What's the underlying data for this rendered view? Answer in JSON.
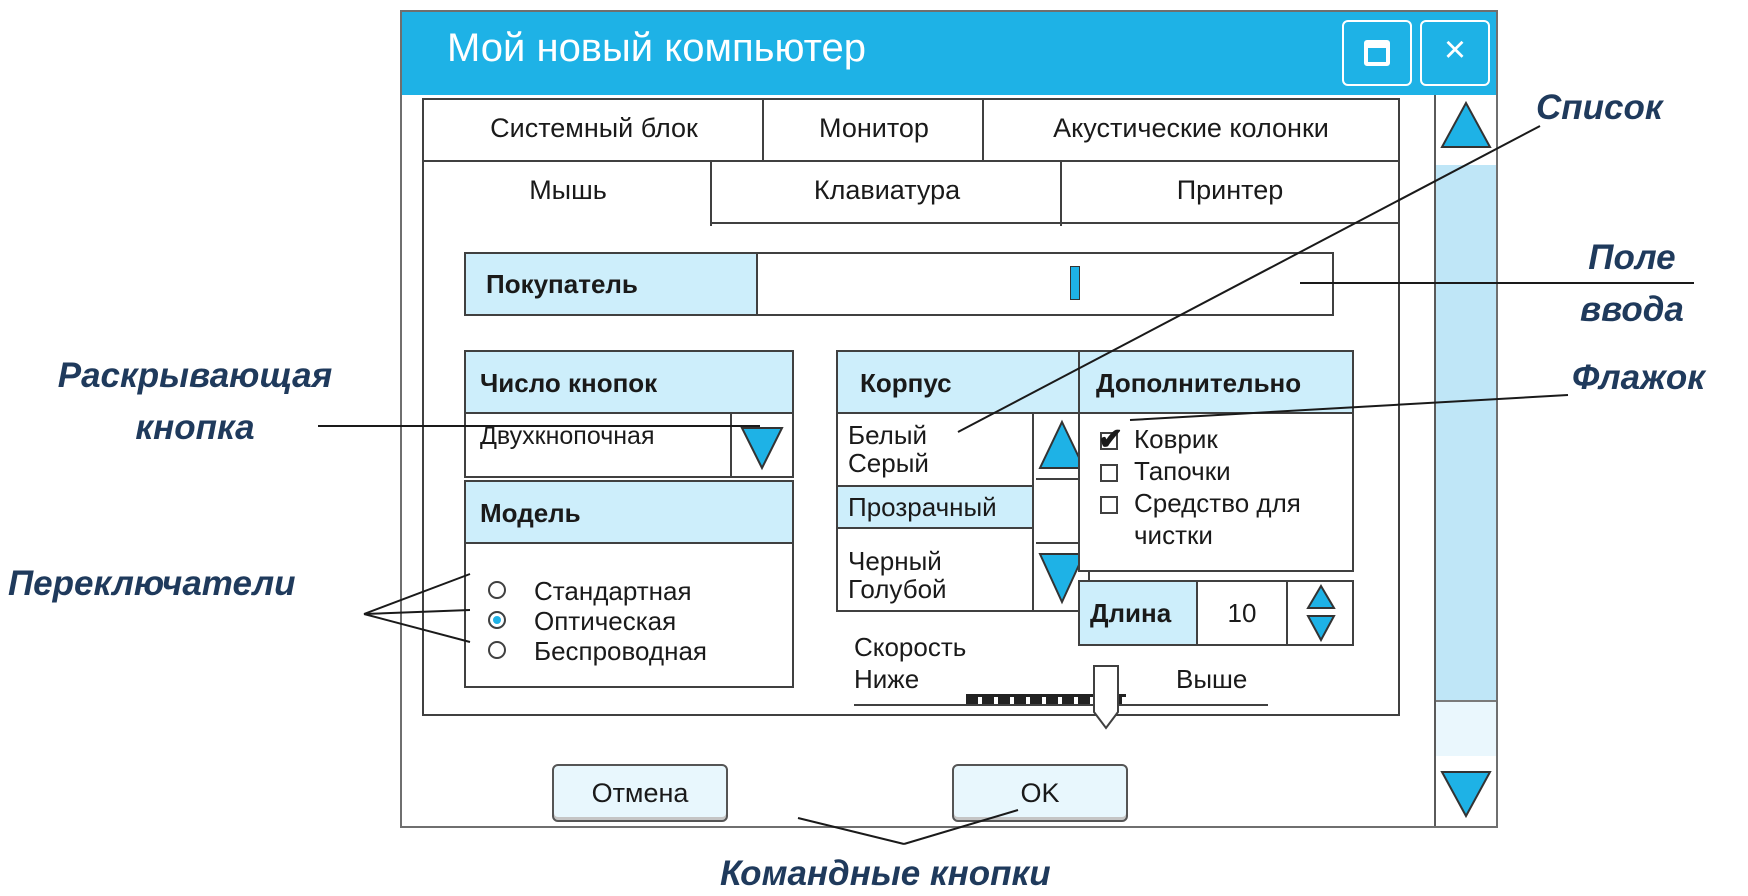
{
  "window": {
    "title": "Мой новый компьютер",
    "maximize_icon": "maximize-icon",
    "close_icon": "close-icon",
    "close_glyph": "×"
  },
  "tabs": {
    "row1": [
      "Системный блок",
      "Монитор",
      "Акустические колонки"
    ],
    "row2": [
      "Мышь",
      "Клавиатура",
      "Принтер"
    ],
    "active": "Мышь"
  },
  "buyer": {
    "label": "Покупатель",
    "value": ""
  },
  "buttons_group": {
    "label": "Число кнопок",
    "selected": "Двухкнопочная"
  },
  "model_group": {
    "label": "Модель",
    "options": [
      "Стандартная",
      "Оптическая",
      "Беспроводная"
    ],
    "selected": "Оптическая"
  },
  "body_group": {
    "label": "Корпус",
    "items": [
      "Белый",
      "Серый",
      "Прозрачный",
      "Черный",
      "Голубой"
    ],
    "selected": "Прозрачный"
  },
  "extra_group": {
    "label": "Дополнительно",
    "items": [
      {
        "label": "Коврик",
        "checked": true
      },
      {
        "label": "Тапочки",
        "checked": false
      },
      {
        "label": "Средство для",
        "label2": "чистки",
        "checked": false
      }
    ]
  },
  "length": {
    "label": "Длина",
    "value": "10"
  },
  "speed": {
    "label": "Скорость",
    "low": "Ниже",
    "high": "Выше",
    "level": 0.8
  },
  "commands": {
    "cancel": "Отмена",
    "ok": "OK"
  },
  "callouts": {
    "list": "Список",
    "input_line1": "Поле",
    "input_line2": "ввода",
    "dropdown_line1": "Раскрывающая",
    "dropdown_line2": "кнопка",
    "checkbox": "Флажок",
    "radios": "Переключатели",
    "commands": "Командные кнопки"
  },
  "colors": {
    "accent": "#1eb2e6",
    "header_fill": "#cdeefb",
    "callout_text": "#1f3a5c"
  }
}
